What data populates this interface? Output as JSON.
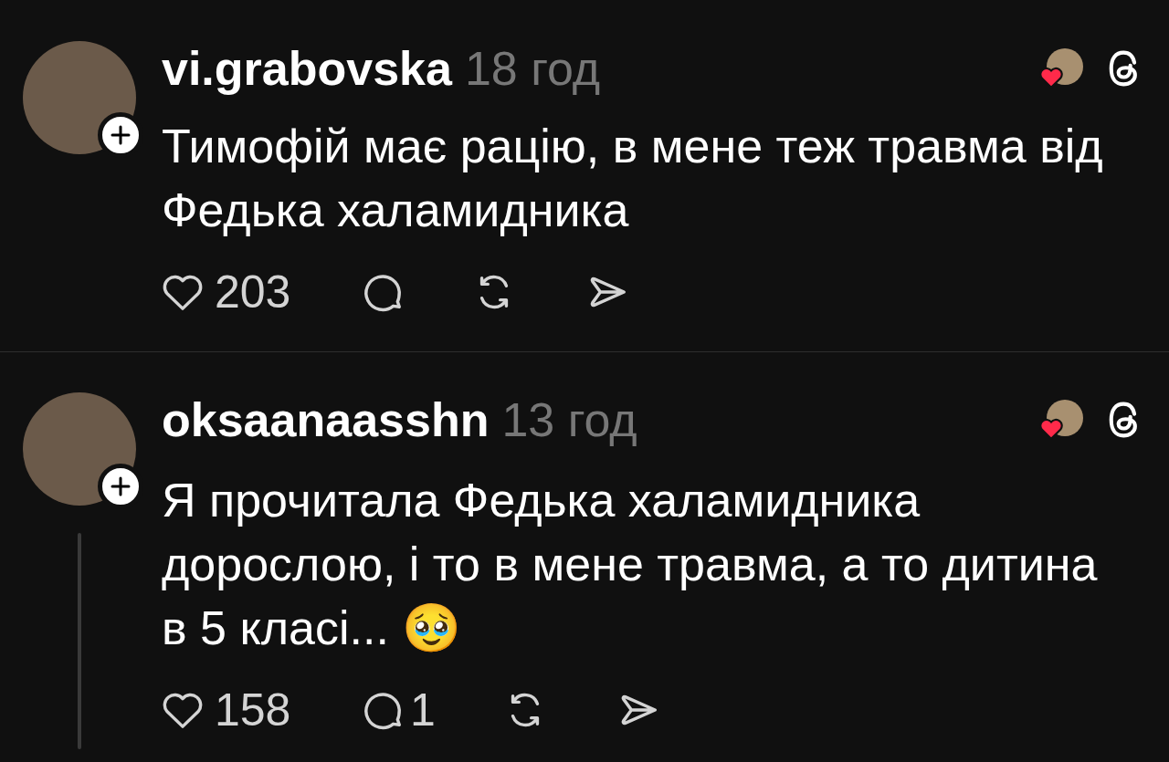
{
  "posts": [
    {
      "username": "vi.grabovska",
      "time": "18 год",
      "text": "Тимофій має рацію, в мене теж травма від Федька халамидника",
      "likes": "203",
      "thread_line": false
    },
    {
      "username": "oksaanaasshn",
      "time": "13 год",
      "text": "Я прочитала Федька халамидника дорослою, і то в мене травма, а то дитина в 5 класі... 🥹",
      "likes": "158",
      "comments": "1",
      "thread_line": true
    }
  ]
}
